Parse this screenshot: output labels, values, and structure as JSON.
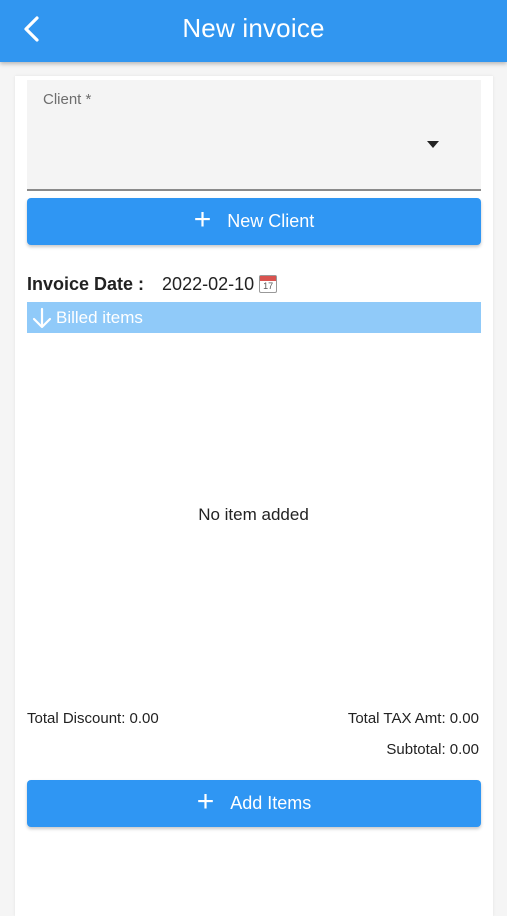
{
  "appbar": {
    "title": "New invoice",
    "back_icon": "arrow-back-icon"
  },
  "form": {
    "client_label": "Client *",
    "client_value": "",
    "dropdown_icon": "chevron-down-icon",
    "new_client_button": "New Client",
    "plus_icon": "plus-icon",
    "invoice_date_label": "Invoice Date :",
    "invoice_date_value": "2022-02-10",
    "calendar_icon": "calendar-icon",
    "calendar_icon_number": "17"
  },
  "billed_items": {
    "header_label": "Billed items",
    "header_icon": "arrow-down-icon",
    "empty_message": "No item added"
  },
  "totals": {
    "total_discount": "Total Discount: 0.00",
    "total_tax": "Total TAX Amt: 0.00",
    "subtotal": "Subtotal: 0.00"
  },
  "actions": {
    "add_items_button": "Add Items"
  },
  "colors": {
    "primary": "#3196f0",
    "billed_header": "#90caf9"
  }
}
